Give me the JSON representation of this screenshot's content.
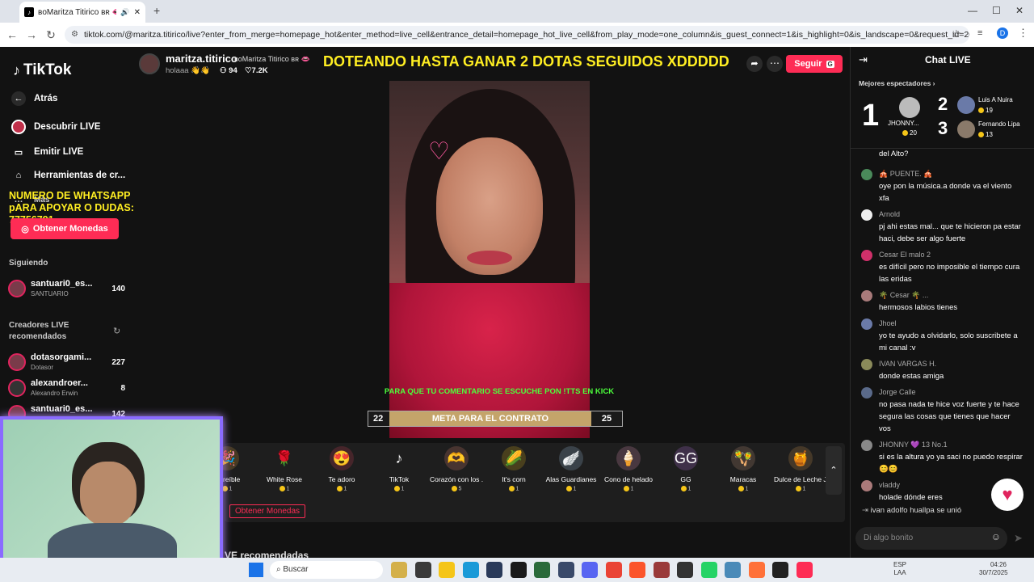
{
  "browser": {
    "tab_title": "ʙoMaritza Titirico ʙʀ 👄 (@",
    "url": "tiktok.com/@maritza.titirico/live?enter_from_merge=homepage_hot&enter_method=live_cell&entrance_detail=homepage_hot_live_cell&from_play_mode=one_column&is_guest_connect=1&is_highlight=0&is_landscape=0&request_id=20250730161033D78...",
    "new_tab": "+",
    "minimize": "—",
    "maximize": "☐",
    "close": "✕",
    "profile": "D"
  },
  "sidebar": {
    "logo": "TikTok",
    "back": "Atrás",
    "items": [
      {
        "label": "Descubrir LIVE"
      },
      {
        "label": "Emitir LIVE"
      },
      {
        "label": "Herramientas de cr..."
      },
      {
        "label": "Más"
      }
    ],
    "overlay_text": "NUMERO DE WHATSAPP pARA APOYAR O DUDAS: 77756791",
    "coins_button": "Obtener Monedas",
    "following_title": "Siguiendo",
    "following": [
      {
        "name": "santuari0_es...",
        "sub": "SANTUARIO",
        "count": "140"
      }
    ],
    "recommended_title": "Creadores LIVE recomendados",
    "recommended": [
      {
        "name": "dotasorgami...",
        "sub": "Dotasor",
        "count": "227"
      },
      {
        "name": "alexandroer...",
        "sub": "Alexandro Erwin",
        "count": "8"
      },
      {
        "name": "santuari0_es...",
        "sub": "",
        "count": "142"
      }
    ]
  },
  "stream": {
    "username": "maritza.titirico",
    "display": "ʙoMaritza Titirico ʙʀ 👄",
    "status": "holaaa 👋👋",
    "viewers": "94",
    "likes": "7.2K",
    "banner": "DOTEANDO HASTA GANAR 2 DOTAS SEGUIDOS XDDDDD",
    "follow": "Seguir",
    "ticker": "PARA QUE TU COMENTARIO SE ESCUCHE PON !TTS EN KICK",
    "goal": {
      "left": "22",
      "label": "META PARA EL CONTRATO",
      "right": "25"
    },
    "obtain": "Obtener Monedas",
    "more_label": "VE recomendadas"
  },
  "gifts": [
    {
      "name": "Increíble",
      "price": "1",
      "icon": "🎉"
    },
    {
      "name": "White Rose",
      "price": "1",
      "icon": "🌹"
    },
    {
      "name": "Te adoro",
      "price": "1",
      "icon": "😍"
    },
    {
      "name": "TikTok",
      "price": "1",
      "icon": "♪"
    },
    {
      "name": "Corazón con los ...",
      "price": "5",
      "icon": "🫶"
    },
    {
      "name": "It's corn",
      "price": "1",
      "icon": "🌽"
    },
    {
      "name": "Alas Guardianes",
      "price": "1",
      "icon": "🪽"
    },
    {
      "name": "Cono de helado",
      "price": "1",
      "icon": "🍦"
    },
    {
      "name": "GG",
      "price": "1",
      "icon": "GG"
    },
    {
      "name": "Maracas",
      "price": "1",
      "icon": "🪇"
    },
    {
      "name": "Dulce de Leche Jar",
      "price": "1",
      "icon": "🍯"
    }
  ],
  "chat": {
    "title": "Chat LIVE",
    "top_title": "Mejores espectadores",
    "top": [
      {
        "rank": "1",
        "name": "JHONNY...",
        "coins": "20"
      },
      {
        "rank": "2",
        "name": "Luis A Nuira",
        "coins": "19"
      },
      {
        "rank": "3",
        "name": "Fernando Lipa",
        "coins": "13"
      }
    ],
    "messages": [
      {
        "user": "",
        "text": "del Alto?",
        "color": "#555"
      },
      {
        "user": "🎪 PUENTE. 🎪",
        "text": "oye pon la música.a donde va el viento xfa",
        "color": "#4a8a5a"
      },
      {
        "user": "Arnold",
        "text": "pj ahi estas mal... que te hicieron pa estar haci, debe ser algo fuerte",
        "color": "#eee"
      },
      {
        "user": "Cesar El malo 2",
        "text": "es difícil pero no imposible el tiempo cura las eridas",
        "color": "#d0306a"
      },
      {
        "user": "🌴 Cesar 🌴 ...",
        "text": "hermosos labios tienes",
        "color": "#a87a7a"
      },
      {
        "user": "Jhoel",
        "text": "yo te ayudo a olvidarlo, solo suscribete a mi canal :v",
        "color": "#6a7aa8"
      },
      {
        "user": "IVAN VARGAS H.",
        "text": "donde estas amiga",
        "color": "#8a8a5a"
      },
      {
        "user": "Jorge Calle",
        "text": "no pasa nada te hice voz fuerte y te hace segura las cosas que tienes que hacer vos",
        "color": "#5a6a8a"
      },
      {
        "user": "JHONNY 💜 13 No.1",
        "text": "si es la altura yo ya saci no puedo respirar😊😊",
        "color": "#888"
      },
      {
        "user": "vladdy",
        "text": "holade dónde eres",
        "color": "#aa7a7a"
      }
    ],
    "join": "ivan adolfo huallpa se unió",
    "input_placeholder": "Di algo bonito"
  },
  "taskbar": {
    "search": "Buscar",
    "lang1": "ESP",
    "lang2": "LAA",
    "time": "04:26",
    "date": "30/7/2025"
  }
}
